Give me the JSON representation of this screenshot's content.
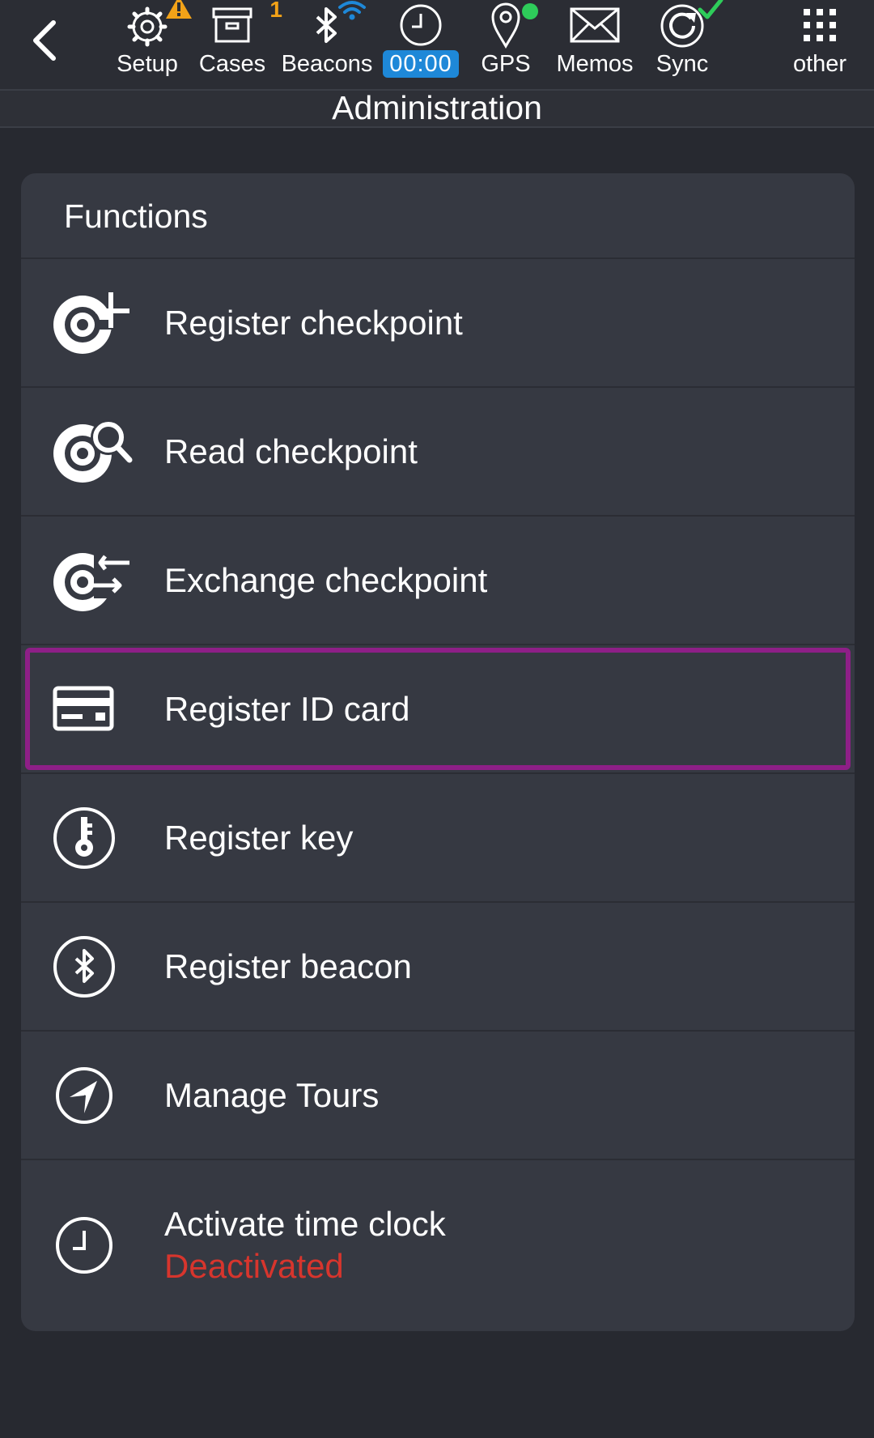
{
  "toolbar": {
    "items": [
      {
        "label": "Setup",
        "icon": "gear-icon",
        "badge_icon": "warning-icon",
        "badge_color": "#f2a218"
      },
      {
        "label": "Cases",
        "icon": "archive-box-icon",
        "badge": "1",
        "badge_color": "#f2a218"
      },
      {
        "label": "Beacons",
        "icon": "bluetooth-icon",
        "badge_icon": "wifi-icon",
        "badge_color": "#1e88d8"
      },
      {
        "label": "00:00",
        "icon": "clock-icon",
        "highlight_color": "#1e88d8"
      },
      {
        "label": "GPS",
        "icon": "map-pin-icon",
        "badge_icon": "status-dot-icon",
        "badge_color": "#2ecc5a"
      },
      {
        "label": "Memos",
        "icon": "envelope-icon"
      },
      {
        "label": "Sync",
        "icon": "sync-icon",
        "badge_icon": "checkmark-icon",
        "badge_color": "#2ecc5a"
      },
      {
        "label": "other",
        "icon": "grid-icon"
      }
    ]
  },
  "page": {
    "title": "Administration"
  },
  "functions": {
    "header": "Functions",
    "items": [
      {
        "label": "Register checkpoint",
        "icon": "checkpoint-add-icon"
      },
      {
        "label": "Read checkpoint",
        "icon": "checkpoint-search-icon"
      },
      {
        "label": "Exchange checkpoint",
        "icon": "checkpoint-exchange-icon"
      },
      {
        "label": "Register ID card",
        "icon": "id-card-icon",
        "selected": true
      },
      {
        "label": "Register key",
        "icon": "key-icon"
      },
      {
        "label": "Register beacon",
        "icon": "bluetooth-circle-icon"
      },
      {
        "label": "Manage Tours",
        "icon": "navigation-arrow-icon"
      },
      {
        "label": "Activate time clock",
        "status": "Deactivated",
        "icon": "clock-icon"
      }
    ]
  },
  "colors": {
    "accent": "#1e88d8",
    "selection": "#8e1f87",
    "warning": "#f2a218",
    "ok": "#2ecc5a",
    "status_inactive": "#d7352d"
  }
}
